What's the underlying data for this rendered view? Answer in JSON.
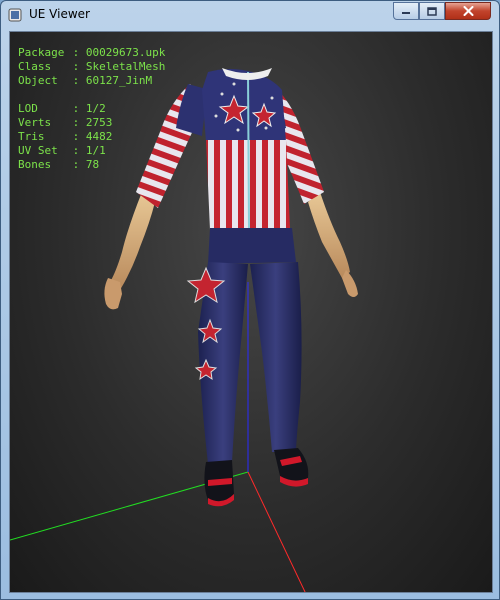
{
  "window": {
    "title": "UE Viewer"
  },
  "info": {
    "package": {
      "label": "Package",
      "value": "00029673.upk"
    },
    "class": {
      "label": "Class",
      "value": "SkeletalMesh"
    },
    "object": {
      "label": "Object",
      "value": "60127_JinM"
    },
    "lod": {
      "label": "LOD",
      "value": "1/2"
    },
    "verts": {
      "label": "Verts",
      "value": "2753"
    },
    "tris": {
      "label": "Tris",
      "value": "4482"
    },
    "uvset": {
      "label": "UV Set",
      "value": "1/1"
    },
    "bones": {
      "label": "Bones",
      "value": "78"
    }
  },
  "colors": {
    "text": "#7ce24a",
    "axis_x": "#ff2a2a",
    "axis_y": "#22dd22",
    "axis_z": "#2a2aff"
  },
  "icons": {
    "app": "app-icon",
    "minimize": "minimize-icon",
    "maximize": "maximize-icon",
    "close": "close-icon"
  }
}
